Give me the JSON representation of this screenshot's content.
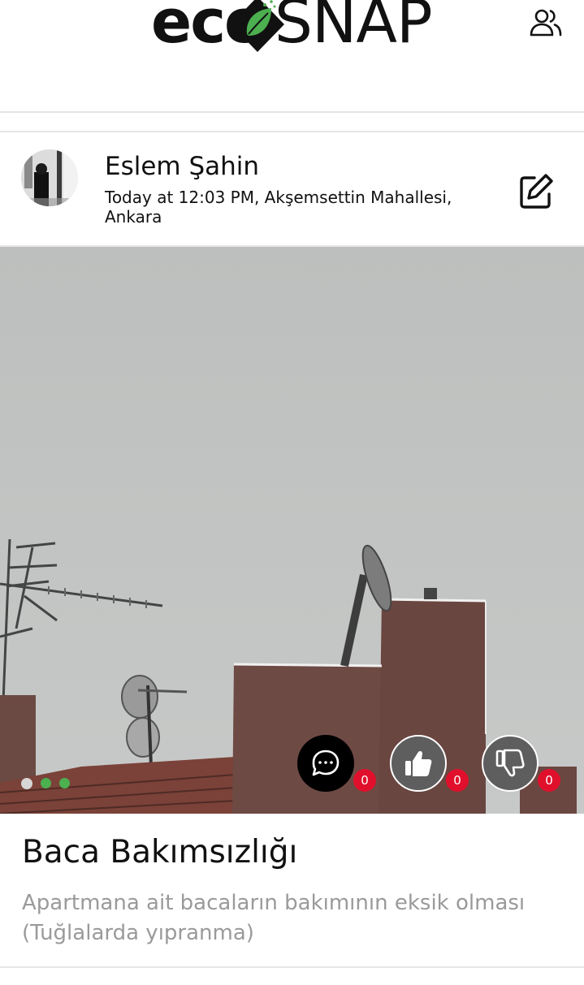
{
  "app": {
    "logo_text_left": "eco",
    "logo_text_right": "SNAP",
    "brand_color": "#4caf50"
  },
  "header": {
    "people_icon": "users-icon"
  },
  "post": {
    "author": "Eslem Şahin",
    "meta": "Today at 12:03 PM, Akşemsettin Mahallesi, Ankara",
    "edit_icon": "edit-icon",
    "title": "Baca Bakımsızlığı",
    "description": "Apartmana ait bacaların bakımının eksik olması (Tuğlalarda yıpranma)",
    "carousel": {
      "total": 3,
      "active_index": 0
    },
    "actions": {
      "comments": {
        "icon": "comment-icon",
        "count": "0"
      },
      "likes": {
        "icon": "thumbs-up-icon",
        "count": "0"
      },
      "dislikes": {
        "icon": "thumbs-down-icon",
        "count": "0"
      }
    },
    "count_badge_color": "#e0102c"
  }
}
